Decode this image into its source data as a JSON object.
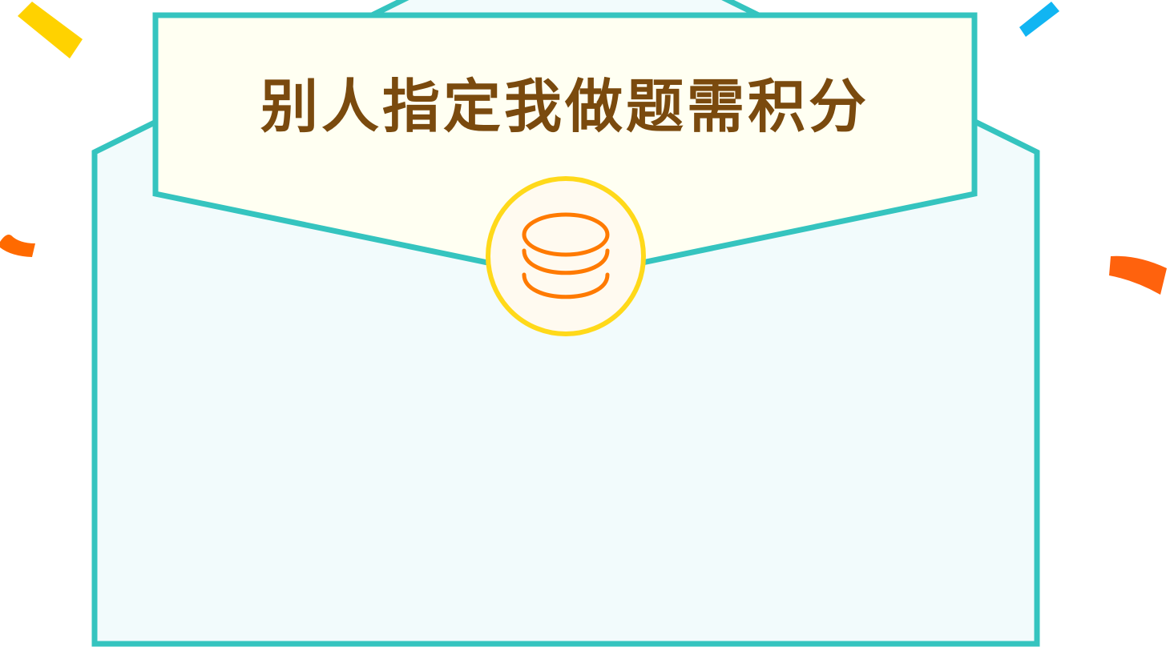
{
  "dialog": {
    "title": "别人指定我做题需积分",
    "icon": "coin-stack-icon"
  },
  "colors": {
    "border": "#35c4bf",
    "envelope_fill": "#f2fbfc",
    "letter_fill": "#fffff2",
    "title_text": "#7a4a0e",
    "badge_ring": "#ffd91a",
    "coin_icon": "#ff7a00",
    "confetti_yellow": "#ffd200",
    "confetti_blue": "#11b5f2",
    "confetti_orange": "#ff6a00"
  }
}
